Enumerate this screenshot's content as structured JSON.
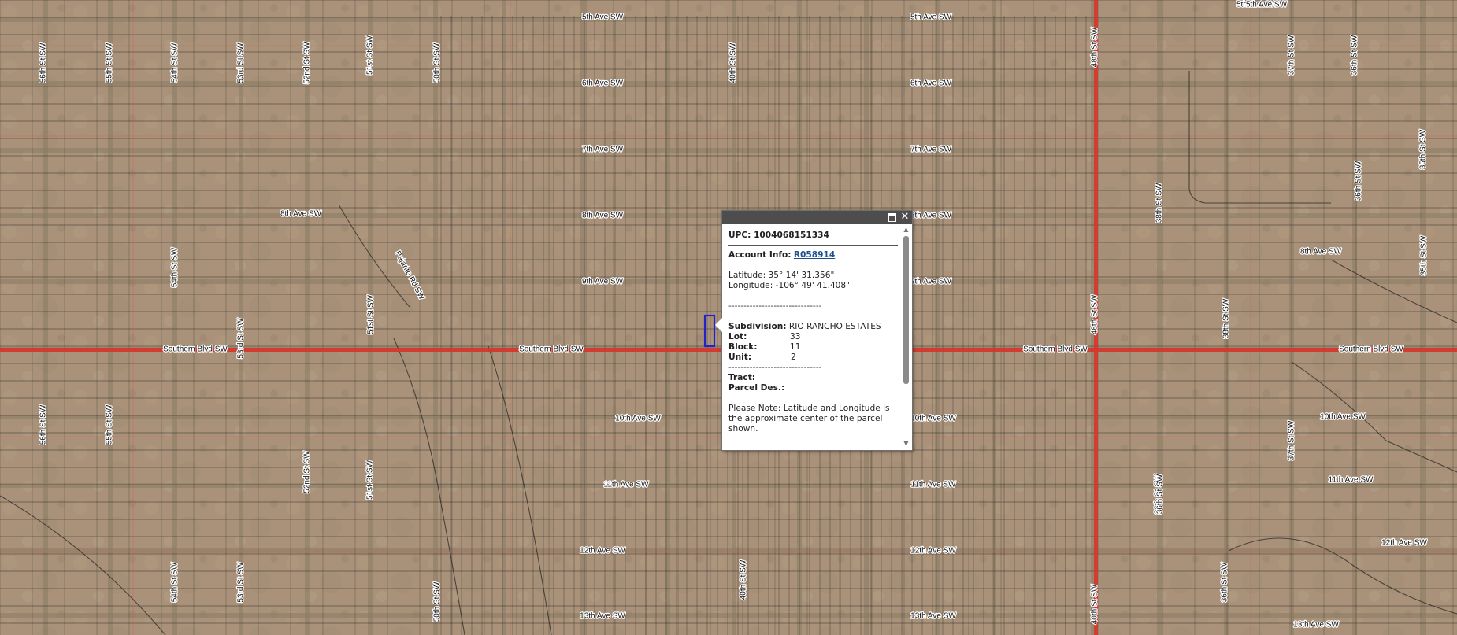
{
  "map": {
    "street_labels_h": [
      {
        "text": "5th Ave SW"
      },
      {
        "text": "5th Ave SW"
      },
      {
        "text": "5th Ave SW"
      },
      {
        "text": "5th Ave SW"
      },
      {
        "text": "6th Ave SW"
      },
      {
        "text": "6th Ave SW"
      },
      {
        "text": "7th Ave SW"
      },
      {
        "text": "7th Ave SW"
      },
      {
        "text": "8th Ave SW"
      },
      {
        "text": "8th Ave SW"
      },
      {
        "text": "8th Ave SW"
      },
      {
        "text": "8th Ave SW"
      },
      {
        "text": "9th Ave SW"
      },
      {
        "text": "9th Ave SW"
      },
      {
        "text": "Southern Blvd SW"
      },
      {
        "text": "Southern Blvd SW"
      },
      {
        "text": "Southern Blvd SW"
      },
      {
        "text": "Southern Blvd SW"
      },
      {
        "text": "10th Ave SW"
      },
      {
        "text": "10th Ave SW"
      },
      {
        "text": "10th Ave SW"
      },
      {
        "text": "11th Ave SW"
      },
      {
        "text": "11th Ave SW"
      },
      {
        "text": "11th Ave SW"
      },
      {
        "text": "12th Ave SW"
      },
      {
        "text": "12th Ave SW"
      },
      {
        "text": "12th Ave SW"
      },
      {
        "text": "13th Ave SW"
      },
      {
        "text": "13th Ave SW"
      },
      {
        "text": "13th Ave SW"
      }
    ],
    "street_labels_v": [
      {
        "text": "56th St SW"
      },
      {
        "text": "55th St SW"
      },
      {
        "text": "54th St SW"
      },
      {
        "text": "53rd St SW"
      },
      {
        "text": "52nd St SW"
      },
      {
        "text": "51st St SW"
      },
      {
        "text": "50th St SW"
      },
      {
        "text": "54th St SW"
      },
      {
        "text": "53rd St SW"
      },
      {
        "text": "56th St SW"
      },
      {
        "text": "55th St SW"
      },
      {
        "text": "52nd St SW"
      },
      {
        "text": "51st St SW"
      },
      {
        "text": "54th St SW"
      },
      {
        "text": "53rd St SW"
      },
      {
        "text": "50th St SW"
      },
      {
        "text": "48th St SW"
      },
      {
        "text": "48th St SW"
      },
      {
        "text": "40th St SW"
      },
      {
        "text": "40th St SW"
      },
      {
        "text": "40th St SW"
      },
      {
        "text": "38th St SW"
      },
      {
        "text": "38th St SW"
      },
      {
        "text": "38th St SW"
      },
      {
        "text": "37th St SW"
      },
      {
        "text": "36th St SW"
      },
      {
        "text": "35th St SW"
      },
      {
        "text": "36th St SW"
      },
      {
        "text": "35th St SW"
      },
      {
        "text": "37th St SW"
      },
      {
        "text": "36th St SW"
      },
      {
        "text": "51st St SW"
      },
      {
        "text": "Pajarito Rd SW"
      },
      {
        "text": "36th St SW"
      }
    ],
    "colors": {
      "ground": "#a8957c",
      "road": "#8a7a64",
      "parcel_line": "#1c1c1c",
      "main_road": "#d8352a",
      "selected_parcel": "#2222cc"
    }
  },
  "popup": {
    "upc_label": "UPC: 1004068151334",
    "account_label": "Account Info:",
    "account_link": "R058914",
    "latitude": "Latitude: 35° 14' 31.356\"",
    "longitude": "Longitude: -106° 49' 41.408\"",
    "divider": "-------------------------------",
    "subdivision_label": "Subdivision:",
    "subdivision_value": "RIO RANCHO ESTATES",
    "lot_label": "Lot:",
    "lot_value": "33",
    "block_label": "Block:",
    "block_value": "11",
    "unit_label": "Unit:",
    "unit_value": "2",
    "tract_label": "Tract:",
    "parcel_label": "Parcel Des.:",
    "note": "Please Note: Latitude and Longitude is the approximate center of the parcel shown.",
    "maximize_icon": "maximize-icon",
    "close_icon": "close-icon",
    "close_glyph": "✕"
  }
}
